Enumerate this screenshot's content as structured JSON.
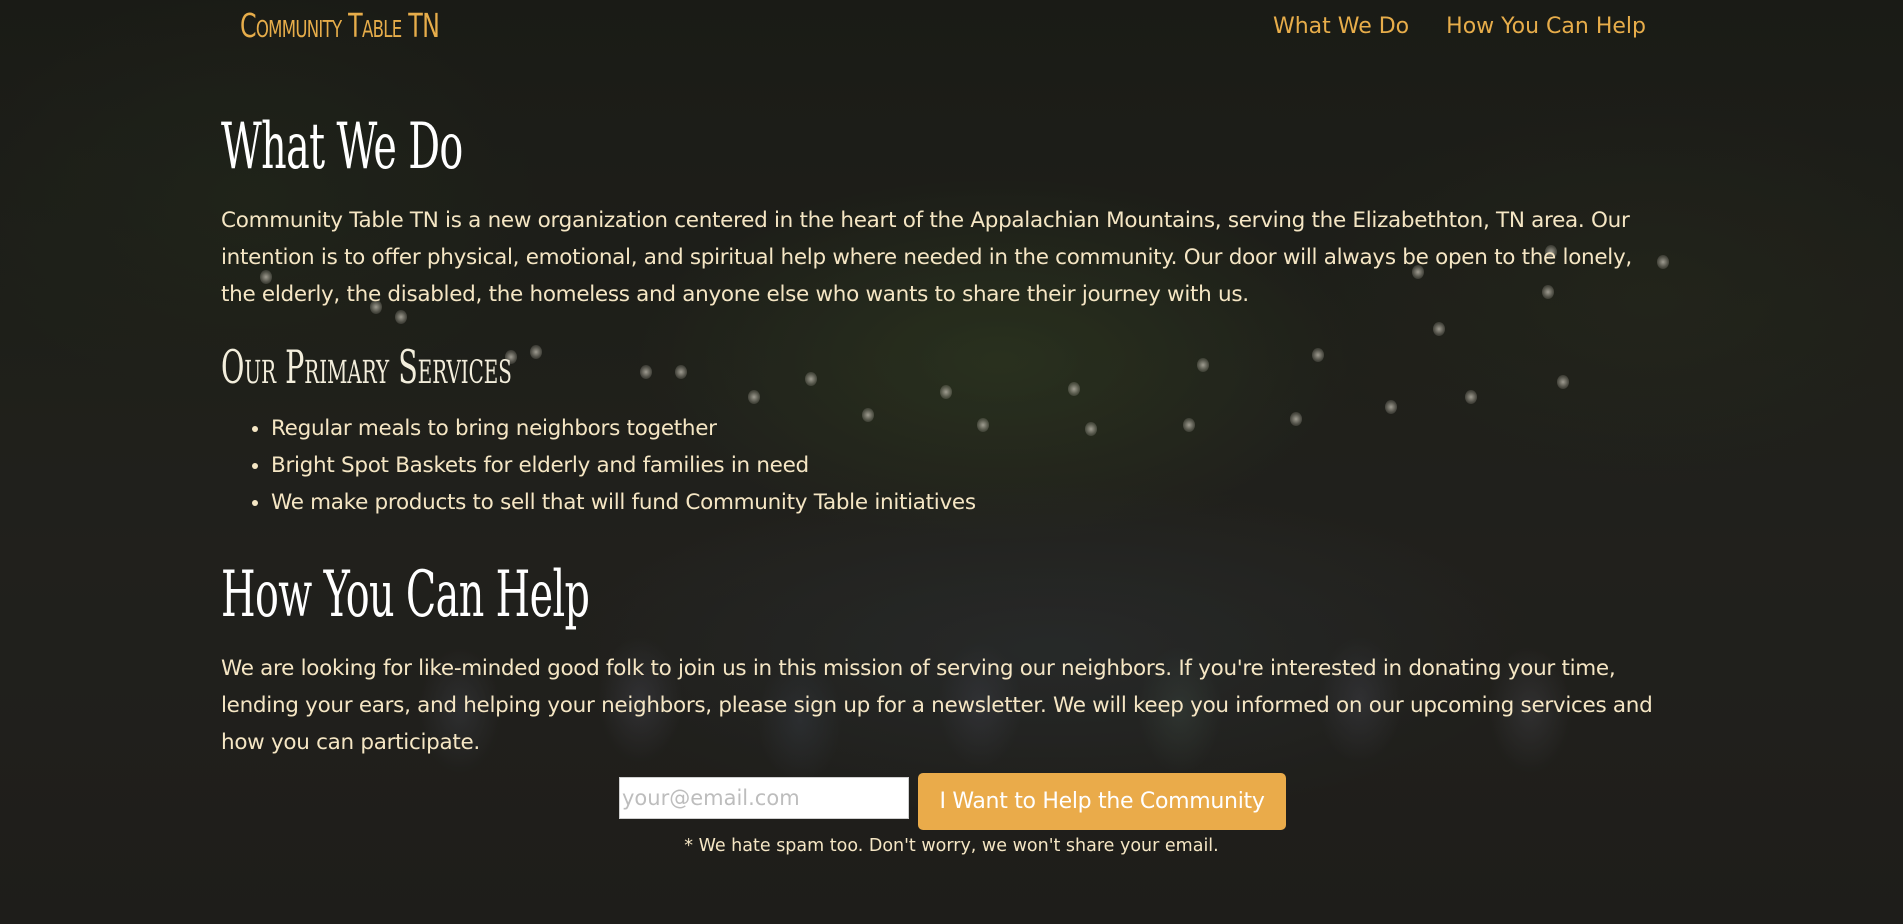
{
  "header": {
    "brand": "Community Table TN",
    "nav": [
      {
        "label": "What We Do"
      },
      {
        "label": "How You Can Help"
      }
    ]
  },
  "what_we_do": {
    "title": "What We Do",
    "body": "Community Table TN is a new organization centered in the heart of the Appalachian Mountains, serving the Elizabethton, TN area. Our intention is to offer physical, emotional, and spiritual help where needed in the community. Our door will always be open to the lonely, the elderly, the disabled, the homeless and anyone else who wants to share their journey with us."
  },
  "services": {
    "title": "Our Primary Services",
    "items": [
      "Regular meals to bring neighbors together",
      "Bright Spot Baskets for elderly and families in need",
      "We make products to sell that will fund Community Table initiatives"
    ]
  },
  "how_you_can_help": {
    "title": "How You Can Help",
    "body": "We are looking for like-minded good folk to join us in this mission of serving our neighbors. If you're interested in donating your time, lending your ears, and helping your neighbors, please sign up for a newsletter. We will keep you informed on our upcoming services and how you can participate."
  },
  "signup": {
    "email_placeholder": "your@email.com",
    "email_value": "",
    "button_label": "I Want to Help the Community",
    "note": "* We hate spam too. Don't worry, we won't share your email."
  },
  "colors": {
    "accent": "#eaab4a",
    "text": "#f5e6c4",
    "heading": "#ffffff"
  }
}
